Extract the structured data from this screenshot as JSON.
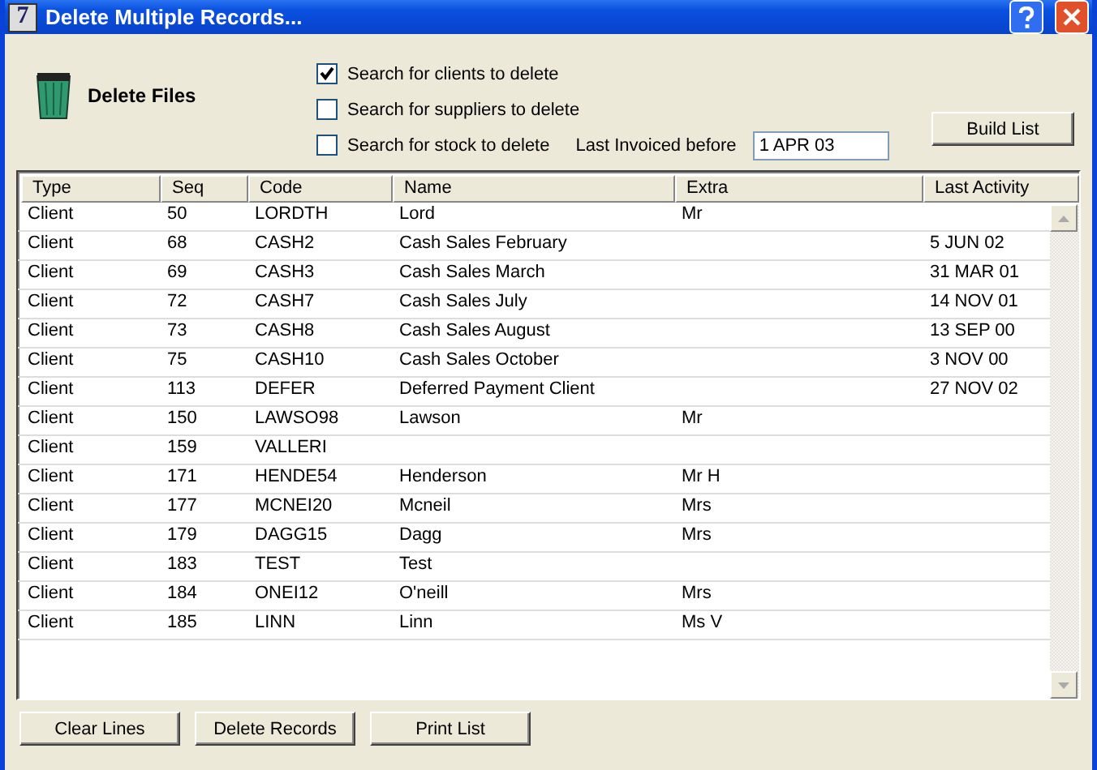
{
  "window": {
    "title": "Delete Multiple Records...",
    "app_icon": "7"
  },
  "heading": "Delete Files",
  "options": [
    {
      "label": "Search for clients to delete",
      "checked": true
    },
    {
      "label": "Search for suppliers to delete",
      "checked": false
    },
    {
      "label": "Search for stock to delete",
      "checked": false
    }
  ],
  "last_invoiced": {
    "label": "Last Invoiced before",
    "value": "1 APR 03"
  },
  "build_button": "Build List",
  "table": {
    "columns": [
      "Type",
      "Seq",
      "Code",
      "Name",
      "Extra",
      "Last Activity"
    ],
    "rows": [
      [
        "Client",
        "50",
        "LORDTH",
        "Lord",
        "Mr",
        ""
      ],
      [
        "Client",
        "68",
        "CASH2",
        "Cash Sales February",
        "",
        "5 JUN 02"
      ],
      [
        "Client",
        "69",
        "CASH3",
        "Cash Sales March",
        "",
        "31 MAR 01"
      ],
      [
        "Client",
        "72",
        "CASH7",
        "Cash Sales July",
        "",
        "14 NOV 01"
      ],
      [
        "Client",
        "73",
        "CASH8",
        "Cash Sales August",
        "",
        "13 SEP 00"
      ],
      [
        "Client",
        "75",
        "CASH10",
        "Cash Sales October",
        "",
        "3 NOV 00"
      ],
      [
        "Client",
        "113",
        "DEFER",
        "Deferred Payment Client",
        "",
        "27 NOV 02"
      ],
      [
        "Client",
        "150",
        "LAWSO98",
        "Lawson",
        "Mr",
        ""
      ],
      [
        "Client",
        "159",
        "VALLERI",
        "",
        "",
        ""
      ],
      [
        "Client",
        "171",
        "HENDE54",
        "Henderson",
        "Mr H",
        ""
      ],
      [
        "Client",
        "177",
        "MCNEI20",
        "Mcneil",
        "Mrs",
        ""
      ],
      [
        "Client",
        "179",
        "DAGG15",
        "Dagg",
        "Mrs",
        ""
      ],
      [
        "Client",
        "183",
        "TEST",
        "Test",
        "",
        ""
      ],
      [
        "Client",
        "184",
        "ONEI12",
        "O'neill",
        "Mrs",
        ""
      ],
      [
        "Client",
        "185",
        "LINN",
        "Linn",
        "Ms V",
        ""
      ]
    ]
  },
  "buttons": [
    "Clear Lines",
    "Delete Records",
    "Print List"
  ]
}
